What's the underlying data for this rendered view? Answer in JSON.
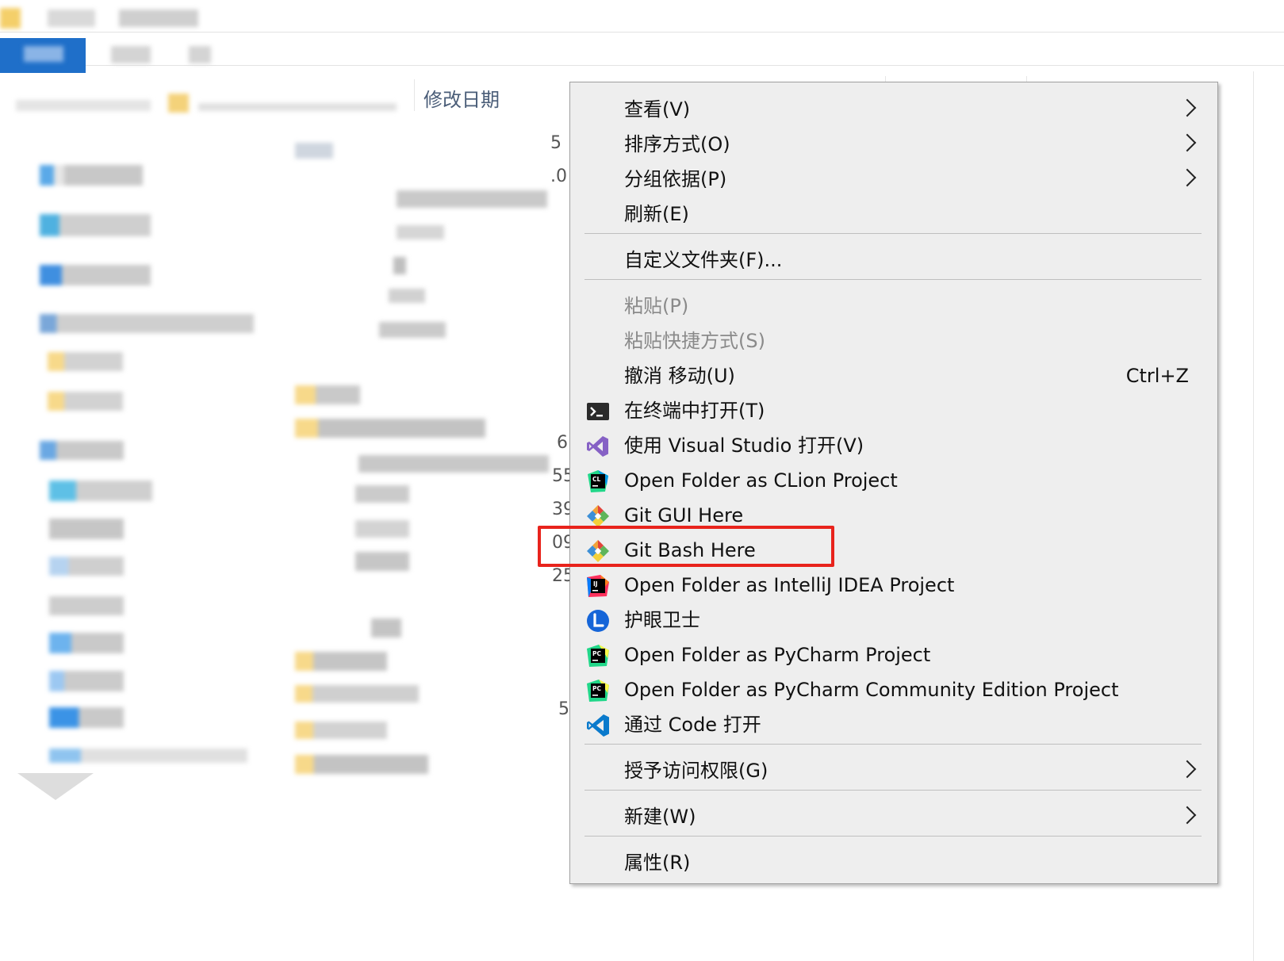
{
  "explorer": {
    "column_header": "修改日期",
    "partial_numbers": [
      "5",
      ".0",
      "6",
      "55",
      "39",
      "09",
      "25",
      "5"
    ]
  },
  "menu": {
    "items": [
      {
        "label": "查看(V)",
        "submenu": true
      },
      {
        "label": "排序方式(O)",
        "submenu": true
      },
      {
        "label": "分组依据(P)",
        "submenu": true
      },
      {
        "label": "刷新(E)"
      },
      {
        "label": "自定义文件夹(F)..."
      },
      {
        "label": "粘贴(P)",
        "disabled": true
      },
      {
        "label": "粘贴快捷方式(S)",
        "disabled": true
      },
      {
        "label": "撤消 移动(U)",
        "shortcut": "Ctrl+Z"
      },
      {
        "label": "在终端中打开(T)",
        "icon": "terminal-icon"
      },
      {
        "label": "使用 Visual Studio 打开(V)",
        "icon": "visual-studio-icon"
      },
      {
        "label": "Open Folder as CLion Project",
        "icon": "clion-icon"
      },
      {
        "label": "Git GUI Here",
        "icon": "git-gui-icon"
      },
      {
        "label": "Git Bash Here",
        "icon": "git-bash-icon",
        "highlighted": true
      },
      {
        "label": "Open Folder as IntelliJ IDEA Project",
        "icon": "intellij-icon"
      },
      {
        "label": "护眼卫士",
        "icon": "eye-guard-icon"
      },
      {
        "label": "Open Folder as PyCharm Project",
        "icon": "pycharm-icon"
      },
      {
        "label": "Open Folder as PyCharm Community Edition Project",
        "icon": "pycharm-ce-icon"
      },
      {
        "label": "通过 Code 打开",
        "icon": "vscode-icon"
      },
      {
        "label": "授予访问权限(G)",
        "submenu": true
      },
      {
        "label": "新建(W)",
        "submenu": true
      },
      {
        "label": "属性(R)"
      }
    ]
  },
  "colors": {
    "menu_bg": "#eeeeee",
    "highlight": "#e8231c",
    "selection_blue": "#1f6fc9"
  }
}
